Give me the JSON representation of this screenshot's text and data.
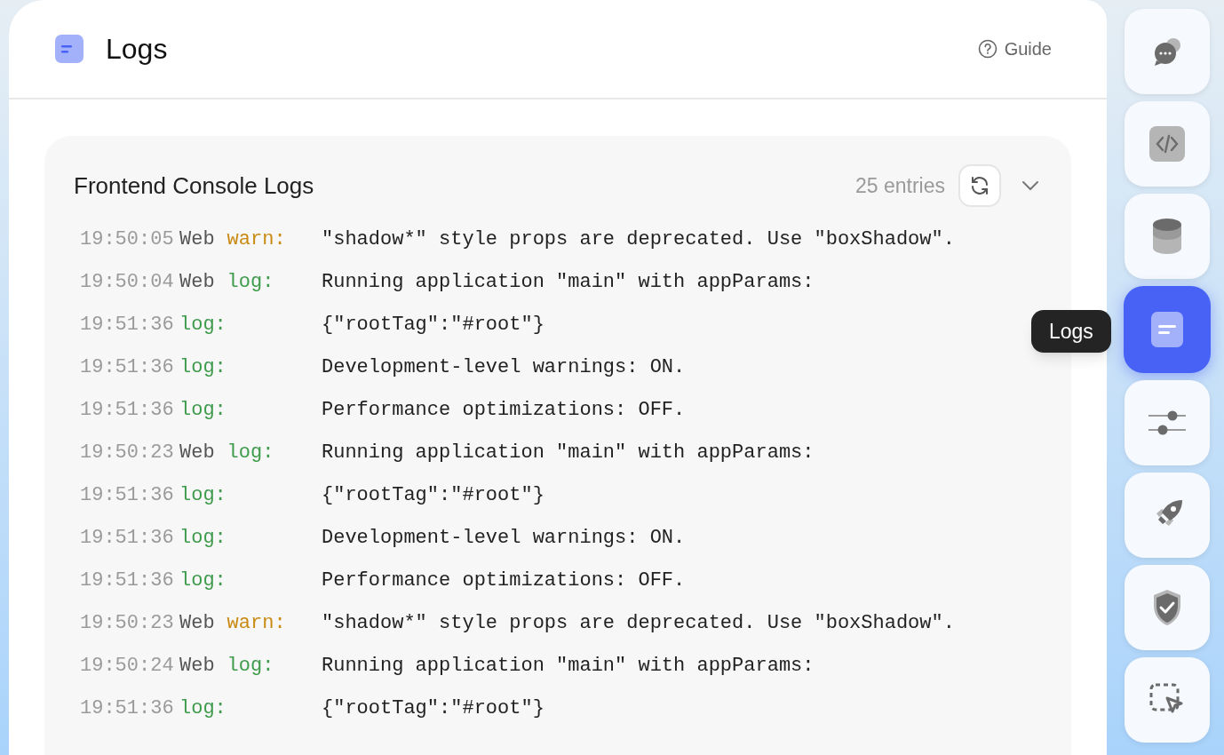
{
  "header": {
    "title": "Logs",
    "guide": "Guide"
  },
  "panel": {
    "title": "Frontend Console Logs",
    "count": "25 entries",
    "expanded": true
  },
  "logs": [
    {
      "time": "19:50:05",
      "source": "Web",
      "level": "warn:",
      "kind": "warn",
      "message": "\"shadow*\" style props are deprecated. Use \"boxShadow\"."
    },
    {
      "time": "19:50:04",
      "source": "Web",
      "level": "log:",
      "kind": "log",
      "message": "Running application \"main\" with appParams:"
    },
    {
      "time": "19:51:36",
      "level": "log:",
      "kind": "log",
      "message": "{\"rootTag\":\"#root\"}"
    },
    {
      "time": "19:51:36",
      "level": "log:",
      "kind": "log",
      "message": "Development-level warnings: ON."
    },
    {
      "time": "19:51:36",
      "level": "log:",
      "kind": "log",
      "message": "Performance optimizations: OFF."
    },
    {
      "time": "19:50:23",
      "source": "Web",
      "level": "log:",
      "kind": "log",
      "message": "Running application \"main\" with appParams:"
    },
    {
      "time": "19:51:36",
      "level": "log:",
      "kind": "log",
      "message": "{\"rootTag\":\"#root\"}"
    },
    {
      "time": "19:51:36",
      "level": "log:",
      "kind": "log",
      "message": "Development-level warnings: ON."
    },
    {
      "time": "19:51:36",
      "level": "log:",
      "kind": "log",
      "message": "Performance optimizations: OFF."
    },
    {
      "time": "19:50:23",
      "source": "Web",
      "level": "warn:",
      "kind": "warn",
      "message": "\"shadow*\" style props are deprecated. Use \"boxShadow\"."
    },
    {
      "time": "19:50:24",
      "source": "Web",
      "level": "log:",
      "kind": "log",
      "message": "Running application \"main\" with appParams:"
    },
    {
      "time": "19:51:36",
      "level": "log:",
      "kind": "log",
      "message": "{\"rootTag\":\"#root\"}"
    }
  ],
  "sidebar": {
    "items": [
      {
        "kind": "chat",
        "selected": false
      },
      {
        "kind": "code",
        "selected": false
      },
      {
        "kind": "database",
        "selected": false
      },
      {
        "kind": "logs",
        "selected": true
      },
      {
        "kind": "sliders",
        "selected": false
      },
      {
        "kind": "rocket",
        "selected": false
      },
      {
        "kind": "shield",
        "selected": false
      },
      {
        "kind": "select",
        "selected": false
      }
    ]
  },
  "tooltip": "Logs"
}
